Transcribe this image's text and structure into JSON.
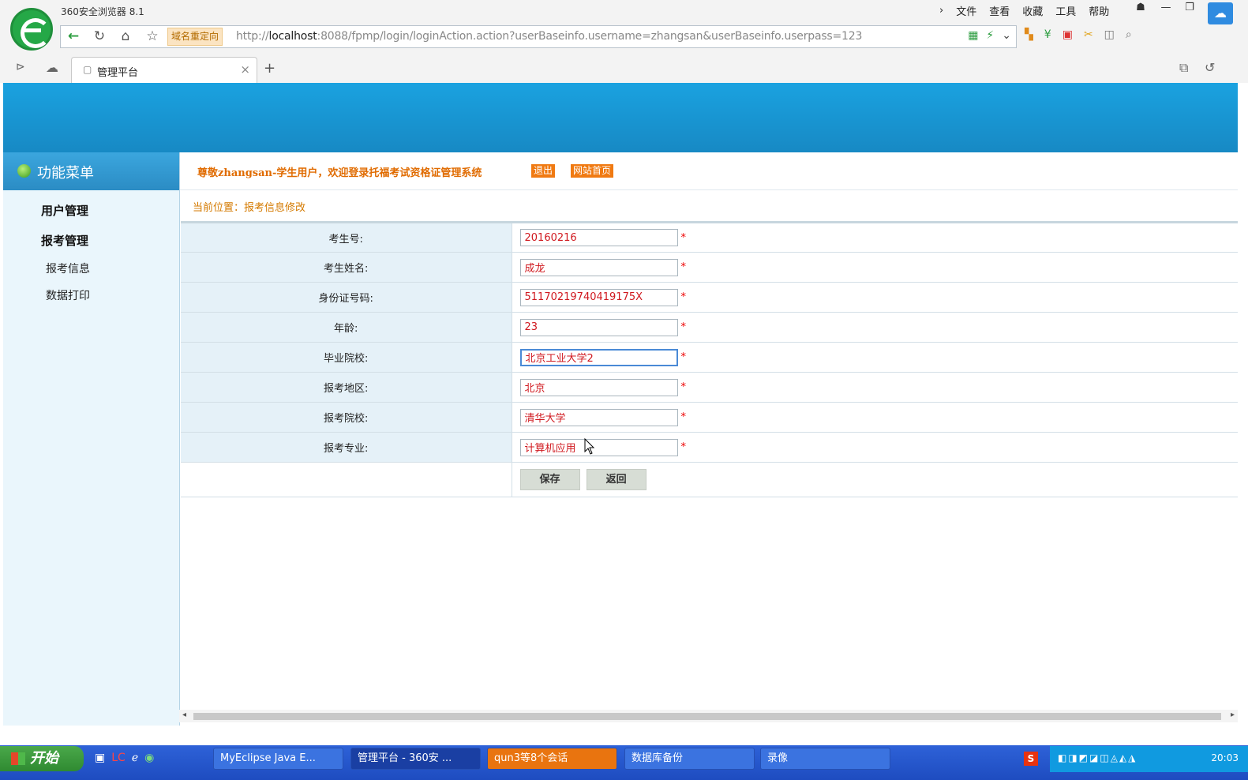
{
  "browser": {
    "title": "360安全浏览器 8.1",
    "menu": [
      "文件",
      "查看",
      "收藏",
      "工具",
      "帮助"
    ],
    "redirect_badge": "域名重定向",
    "url_prefix": "http://",
    "url_host": "localhost",
    "url_rest": ":8088/fpmp/login/loginAction.action?userBaseinfo.username=zhangsan&userBaseinfo.userpass=123",
    "tab_title": "管理平台",
    "new_tab": "+",
    "close_tab": "×"
  },
  "sidebar": {
    "title": "功能菜单",
    "groups": [
      {
        "label": "用户管理"
      },
      {
        "label": "报考管理"
      }
    ],
    "links": [
      {
        "label": "报考信息"
      },
      {
        "label": "数据打印"
      }
    ]
  },
  "main": {
    "welcome": "尊敬zhangsan-学生用户，欢迎登录托福考试资格证管理系统",
    "logout": "退出",
    "home": "网站首页",
    "breadcrumb": "当前位置：报考信息修改",
    "required_mark": "*",
    "fields": [
      {
        "label": "考生号:",
        "value": "20160216"
      },
      {
        "label": "考生姓名:",
        "value": "成龙"
      },
      {
        "label": "身份证号码:",
        "value": "51170219740419175X"
      },
      {
        "label": "年龄:",
        "value": "23"
      },
      {
        "label": "毕业院校:",
        "value": "北京工业大学2"
      },
      {
        "label": "报考地区:",
        "value": "北京"
      },
      {
        "label": "报考院校:",
        "value": "清华大学"
      },
      {
        "label": "报考专业:",
        "value": "计算机应用"
      }
    ],
    "save_label": "保存",
    "back_label": "返回"
  },
  "taskbar": {
    "start_label": "开始",
    "tasks": [
      {
        "label": "MyEclipse Java E..."
      },
      {
        "label": "管理平台 - 360安 ..."
      },
      {
        "label": "qun3等8个会话"
      },
      {
        "label": "数据库备份"
      },
      {
        "label": "录像"
      }
    ],
    "clock": "20:03"
  }
}
